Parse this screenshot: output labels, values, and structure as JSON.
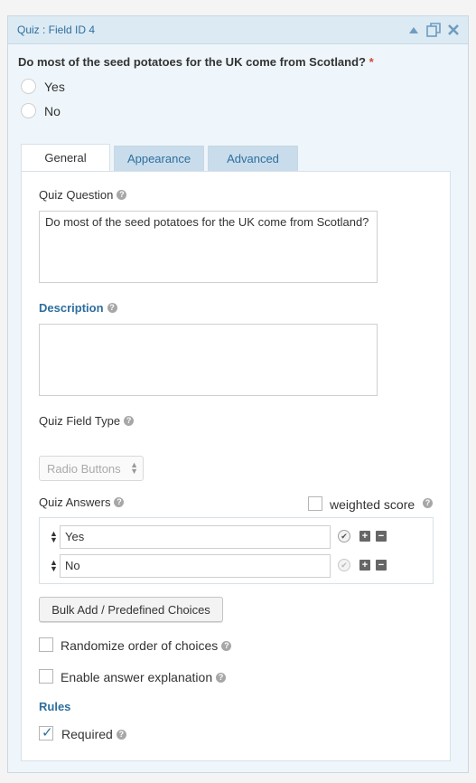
{
  "header": {
    "title": "Quiz : Field ID 4"
  },
  "preview": {
    "question": "Do most of the seed potatoes for the UK come from Scotland?",
    "required_marker": "*",
    "choices": [
      "Yes",
      "No"
    ]
  },
  "tabs": [
    "General",
    "Appearance",
    "Advanced"
  ],
  "general": {
    "quiz_question_label": "Quiz Question",
    "quiz_question_value": "Do most of the seed potatoes for the UK come from Scotland?",
    "description_label": "Description",
    "description_value": "",
    "field_type_label": "Quiz Field Type",
    "field_type_value": "Radio Buttons",
    "answers_label": "Quiz Answers",
    "weighted_score_label": "weighted score",
    "answers": [
      {
        "value": "Yes",
        "correct": true
      },
      {
        "value": "No",
        "correct": false
      }
    ],
    "bulk_add_label": "Bulk Add / Predefined Choices",
    "randomize_label": "Randomize order of choices",
    "explanation_label": "Enable answer explanation",
    "rules_label": "Rules",
    "required_label": "Required",
    "required_checked": true
  },
  "help_glyph": "?"
}
